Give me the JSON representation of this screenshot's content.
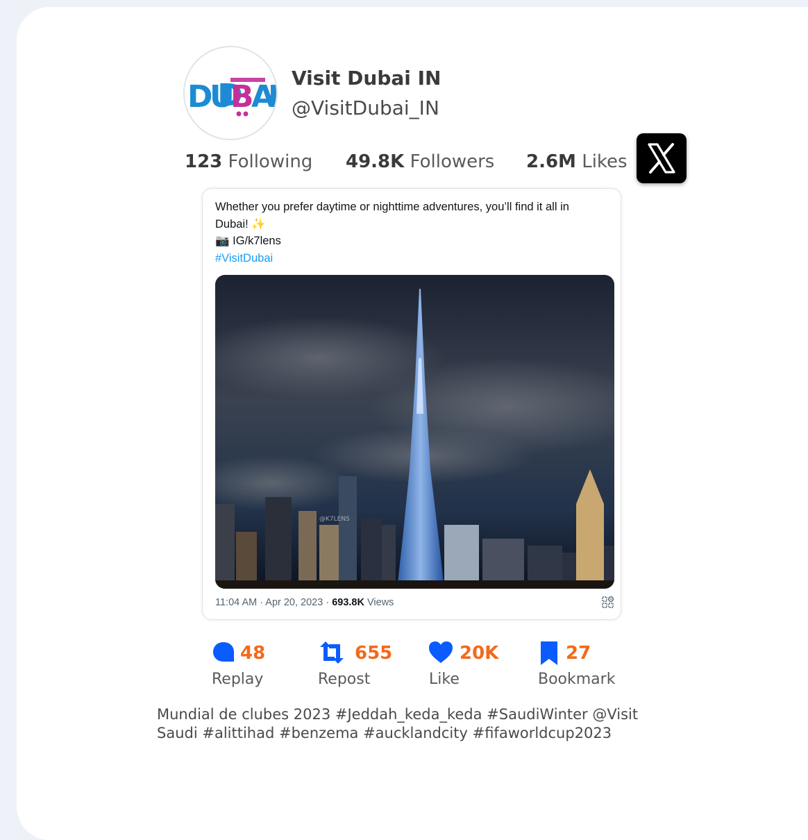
{
  "profile": {
    "name": "Visit Dubai IN",
    "handle": "@VisitDubai_IN",
    "logo_text": "DUBAI"
  },
  "stats": {
    "following_count": "123",
    "following_label": "Following",
    "followers_count": "49.8K",
    "followers_label": "Followers",
    "likes_count": "2.6M",
    "likes_label": "Likes"
  },
  "tweet": {
    "line1": "Whether you prefer daytime or nighttime adventures, you’ll find it all in",
    "line2": "Dubai!",
    "line2_emoji": "✨",
    "line3_emoji": "📷",
    "line3": "IG/k7lens",
    "hashtag": "#VisitDubai",
    "time": "11:04 AM · Apr 20, 2023 · ",
    "views_count": "693.8K",
    "views_label": " Views",
    "watermark": "@K7LENS"
  },
  "actions": {
    "reply_count": "48",
    "reply_label": "Replay",
    "repost_count": "655",
    "repost_label": "Repost",
    "like_count": "20K",
    "like_label": "Like",
    "bookmark_count": "27",
    "bookmark_label": "Bookmark"
  },
  "caption": {
    "line1": "Mundial de clubes 2023 #Jeddah_keda_keda #SaudiWinter @Visit",
    "line2": "Saudi #alittihad #benzema #aucklandcity #fifaworldcup2023"
  },
  "colors": {
    "accent_orange": "#f26a1b",
    "icon_blue": "#0a5cff",
    "link_blue": "#1d9bf0",
    "logo_blue": "#1c8bd4",
    "logo_magenta": "#c4309a"
  },
  "icons": {
    "reply": "comment-bubble-icon",
    "repost": "repost-icon",
    "like": "heart-icon",
    "bookmark": "bookmark-icon",
    "x_logo": "x-logo-icon",
    "qr": "qr-code-icon"
  }
}
